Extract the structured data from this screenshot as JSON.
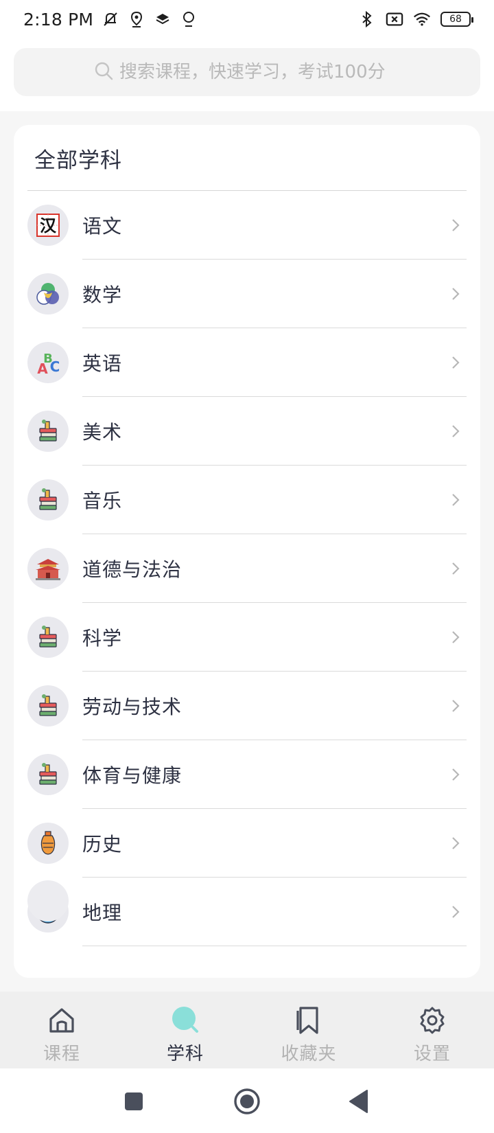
{
  "status_bar": {
    "time": "2:18 PM",
    "battery": "68"
  },
  "search": {
    "placeholder": "搜索课程，快速学习，考试100分"
  },
  "card": {
    "title": "全部学科"
  },
  "subjects": [
    {
      "label": "语文",
      "icon": "hanzi-icon"
    },
    {
      "label": "数学",
      "icon": "venn-diagram-icon"
    },
    {
      "label": "英语",
      "icon": "abc-letters-icon"
    },
    {
      "label": "美术",
      "icon": "books-stack-icon"
    },
    {
      "label": "音乐",
      "icon": "books-stack-icon"
    },
    {
      "label": "道德与法治",
      "icon": "palace-icon"
    },
    {
      "label": "科学",
      "icon": "books-stack-icon"
    },
    {
      "label": "劳动与技术",
      "icon": "books-stack-icon"
    },
    {
      "label": "体育与健康",
      "icon": "books-stack-icon"
    },
    {
      "label": "历史",
      "icon": "vase-icon"
    },
    {
      "label": "地理",
      "icon": "globe-icon"
    }
  ],
  "tabs": [
    {
      "label": "课程",
      "icon": "home-icon",
      "active": false
    },
    {
      "label": "学科",
      "icon": "search-icon",
      "active": true
    },
    {
      "label": "收藏夹",
      "icon": "bookmark-icon",
      "active": false
    },
    {
      "label": "设置",
      "icon": "gear-icon",
      "active": false
    }
  ],
  "colors": {
    "accent": "#8adfd9",
    "text_primary": "#2d3142",
    "text_inactive": "#b3b3b3",
    "background": "#f6f6f6"
  }
}
